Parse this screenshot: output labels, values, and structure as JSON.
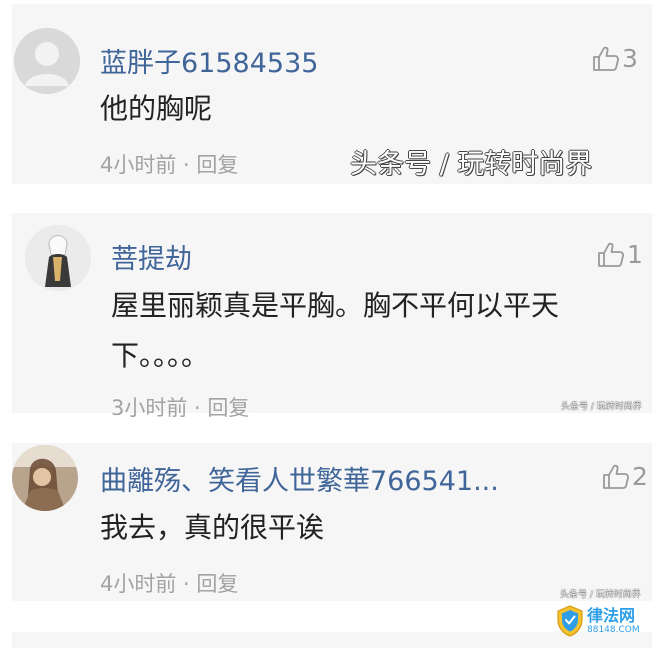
{
  "comments": [
    {
      "username": "蓝胖子61584535",
      "text_lines": [
        "他的胸呢"
      ],
      "meta": "4小时前 · 回复",
      "likes": "3"
    },
    {
      "username": "菩提劫",
      "text_lines": [
        "屋里丽颖真是平胸。胸不平何以平天",
        "下。。。。"
      ],
      "meta": "3小时前 · 回复",
      "likes": "1"
    },
    {
      "username": "曲離殇、笑看人世繁華766541...",
      "text_lines": [
        "我去，真的很平诶"
      ],
      "meta": "4小时前 · 回复",
      "likes": "2"
    }
  ],
  "watermark": "头条号 / 玩转时尚界",
  "small_watermarks": [
    "头条号 / 玩转时尚界",
    "头条号 / 玩转时尚界"
  ],
  "logo": {
    "name": "律法网",
    "url": "88148.COM"
  },
  "icons": {
    "like": "thumbs-up-icon",
    "default_avatar": "person-silhouette-icon"
  },
  "colors": {
    "username": "#406599",
    "text": "#222222",
    "meta": "#a3a3a3",
    "card_bg": "#f6f6f6",
    "logo": "#2e9ee6"
  }
}
